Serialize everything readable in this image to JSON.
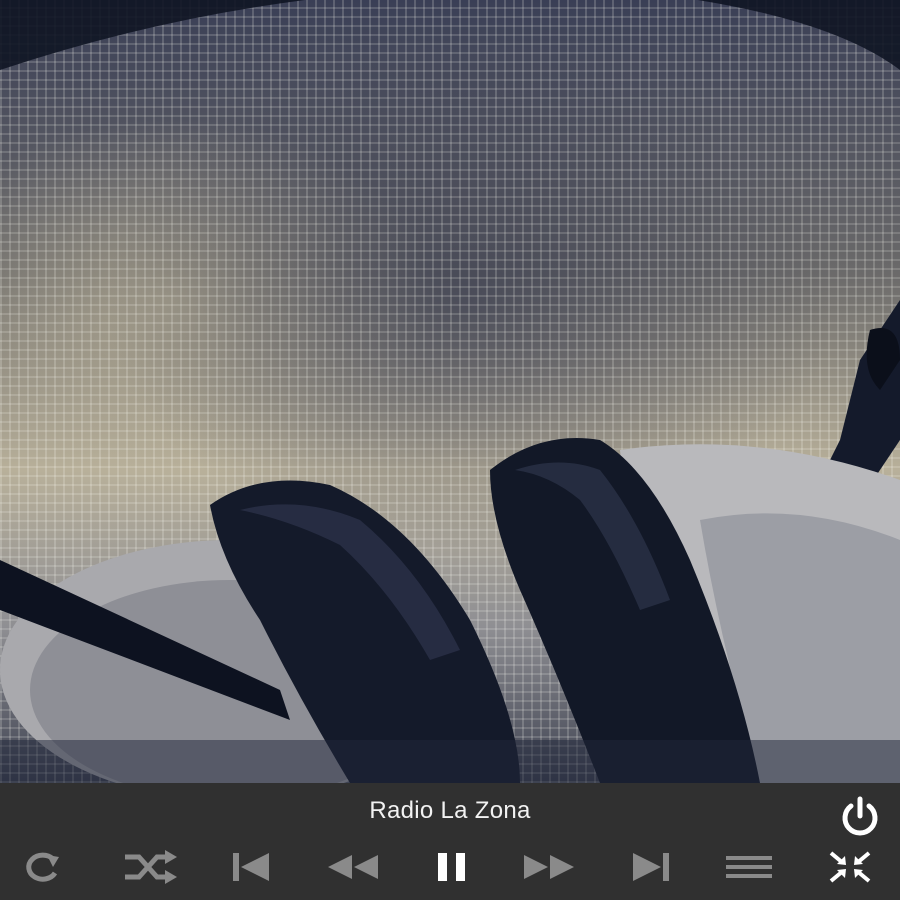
{
  "player": {
    "station_title": "Radio La Zona"
  },
  "artwork": {
    "icon": "headphones-artwork"
  },
  "controls": {
    "power": {
      "icon": "power-icon"
    },
    "buttons": [
      {
        "id": "repeat",
        "icon": "repeat-icon"
      },
      {
        "id": "shuffle",
        "icon": "shuffle-icon"
      },
      {
        "id": "skip-previous",
        "icon": "skip-previous-icon"
      },
      {
        "id": "rewind",
        "icon": "rewind-icon"
      },
      {
        "id": "pause",
        "icon": "pause-icon"
      },
      {
        "id": "fast-forward",
        "icon": "fast-forward-icon"
      },
      {
        "id": "skip-next",
        "icon": "skip-next-icon"
      },
      {
        "id": "menu",
        "icon": "menu-icon"
      },
      {
        "id": "minimize",
        "icon": "minimize-icon"
      }
    ]
  },
  "colors": {
    "bar_background": "#303030",
    "icon_muted": "#8a8a8a",
    "icon_active": "#ffffff"
  }
}
